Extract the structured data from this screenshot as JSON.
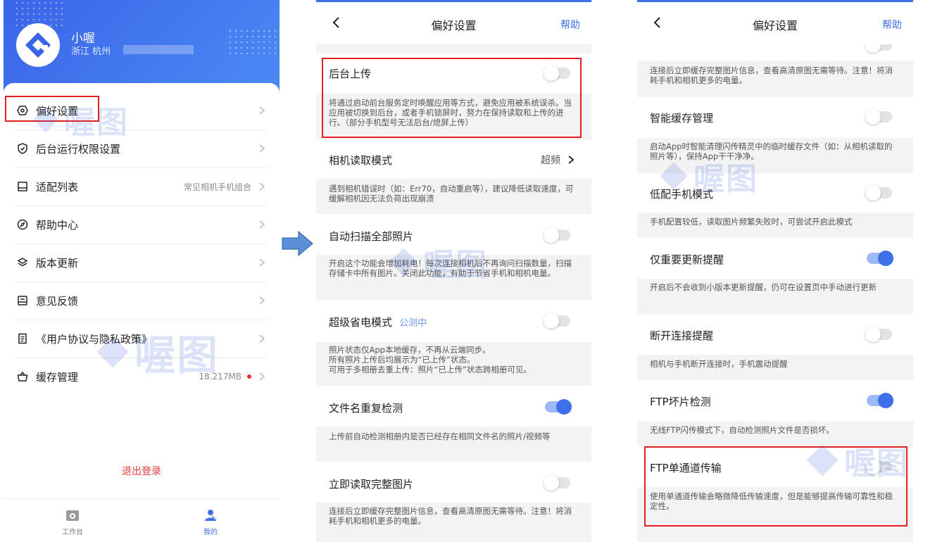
{
  "profile": {
    "name": "小喔",
    "location": "浙江 杭州"
  },
  "menu": [
    {
      "label": "偏好设置",
      "value": "",
      "icon": "settings-hexagon-icon"
    },
    {
      "label": "后台运行权限设置",
      "value": "",
      "icon": "shield-check-icon"
    },
    {
      "label": "适配列表",
      "value": "常见相机手机组合",
      "icon": "device-list-icon"
    },
    {
      "label": "帮助中心",
      "value": "",
      "icon": "compass-icon"
    },
    {
      "label": "版本更新",
      "value": "",
      "icon": "layers-icon"
    },
    {
      "label": "意见反馈",
      "value": "",
      "icon": "feedback-icon"
    },
    {
      "label": "《用户协议与隐私政策》",
      "value": "",
      "icon": "document-icon"
    },
    {
      "label": "缓存管理",
      "value": "18.217MB",
      "icon": "basket-icon"
    }
  ],
  "logout_label": "退出登录",
  "tabs": [
    {
      "label": "工作台"
    },
    {
      "label": "我的"
    }
  ],
  "nav": {
    "title": "偏好设置",
    "help": "帮助"
  },
  "panel2": {
    "bg_upload": {
      "label": "后台上传",
      "on": false,
      "desc": "将通过启动前台服务定时唤醒应用等方式，避免应用被系统误杀。当应用被切换到后台，或者手机锁屏时，努力在保持读取和上传的进行。（部分手机型号无法后台/熄屏上传）"
    },
    "camera_mode": {
      "label": "相机读取模式",
      "value": "超频",
      "desc": "遇到相机错误时（如：Err70，自动重启等），建议降低读取速度，可缓解相机因无法负荷出现崩溃"
    },
    "auto_scan": {
      "label": "自动扫描全部照片",
      "on": false,
      "desc": "开启这个功能会增加耗电！每次连接相机后不再询问扫描数量，扫描存储卡中所有图片。关闭此功能，有助于节省手机和相机电量。"
    },
    "power_save": {
      "label": "超级省电模式",
      "tag": "公测中",
      "on": false,
      "desc_lines": [
        "照片状态仅App本地缓存，不再从云端同步。",
        "所有照片上传后均展示为“已上传”状态。",
        "可用于多相册去重上传：照片“已上传”状态跨相册可见。"
      ]
    },
    "dup_check": {
      "label": "文件名重复检测",
      "on": true,
      "desc": "上传前自动检测相册内是否已经存在相同文件名的照片/视频等"
    },
    "full_read": {
      "label": "立即读取完整图片",
      "on": false,
      "desc": "连接后立即缓存完整图片信息，查看高清原图无需等待。注意！将消耗手机和相机更多的电量。"
    }
  },
  "panel3": {
    "top_desc": "连接后立即缓存完整图片信息，查看高清原图无需等待。注意！将消耗手机和相机更多的电量。",
    "smart_cache": {
      "label": "智能缓存管理",
      "on": false,
      "desc": "启动App时智能清理闪传精灵中的临时缓存文件（如：从相机读取的照片等），保持App干干净净。"
    },
    "low_end": {
      "label": "低配手机模式",
      "on": false,
      "desc": "手机配置较低，读取图片频繁失败时，可尝试开启此模式"
    },
    "major_update": {
      "label": "仅重要更新提醒",
      "on": true,
      "desc": "开启后不会收到小版本更新提醒，仍可在设置页中手动进行更新"
    },
    "disconnect": {
      "label": "断开连接提醒",
      "on": false,
      "desc": "相机与手机断开连接时，手机震动提醒"
    },
    "ftp_check": {
      "label": "FTP坏片检测",
      "on": true,
      "desc": "无线FTP闪传模式下，自动检测照片文件是否损坏。"
    },
    "ftp_single": {
      "label": "FTP单通道传输",
      "on": false,
      "desc": "使用单通道传输会略微降低传输速度，但是能够提高传输可靠性和稳定性。"
    }
  },
  "watermark": "喔图",
  "colors": {
    "accent": "#3d6fe8",
    "highlight": "#e62020",
    "logout": "#e83b3b"
  }
}
